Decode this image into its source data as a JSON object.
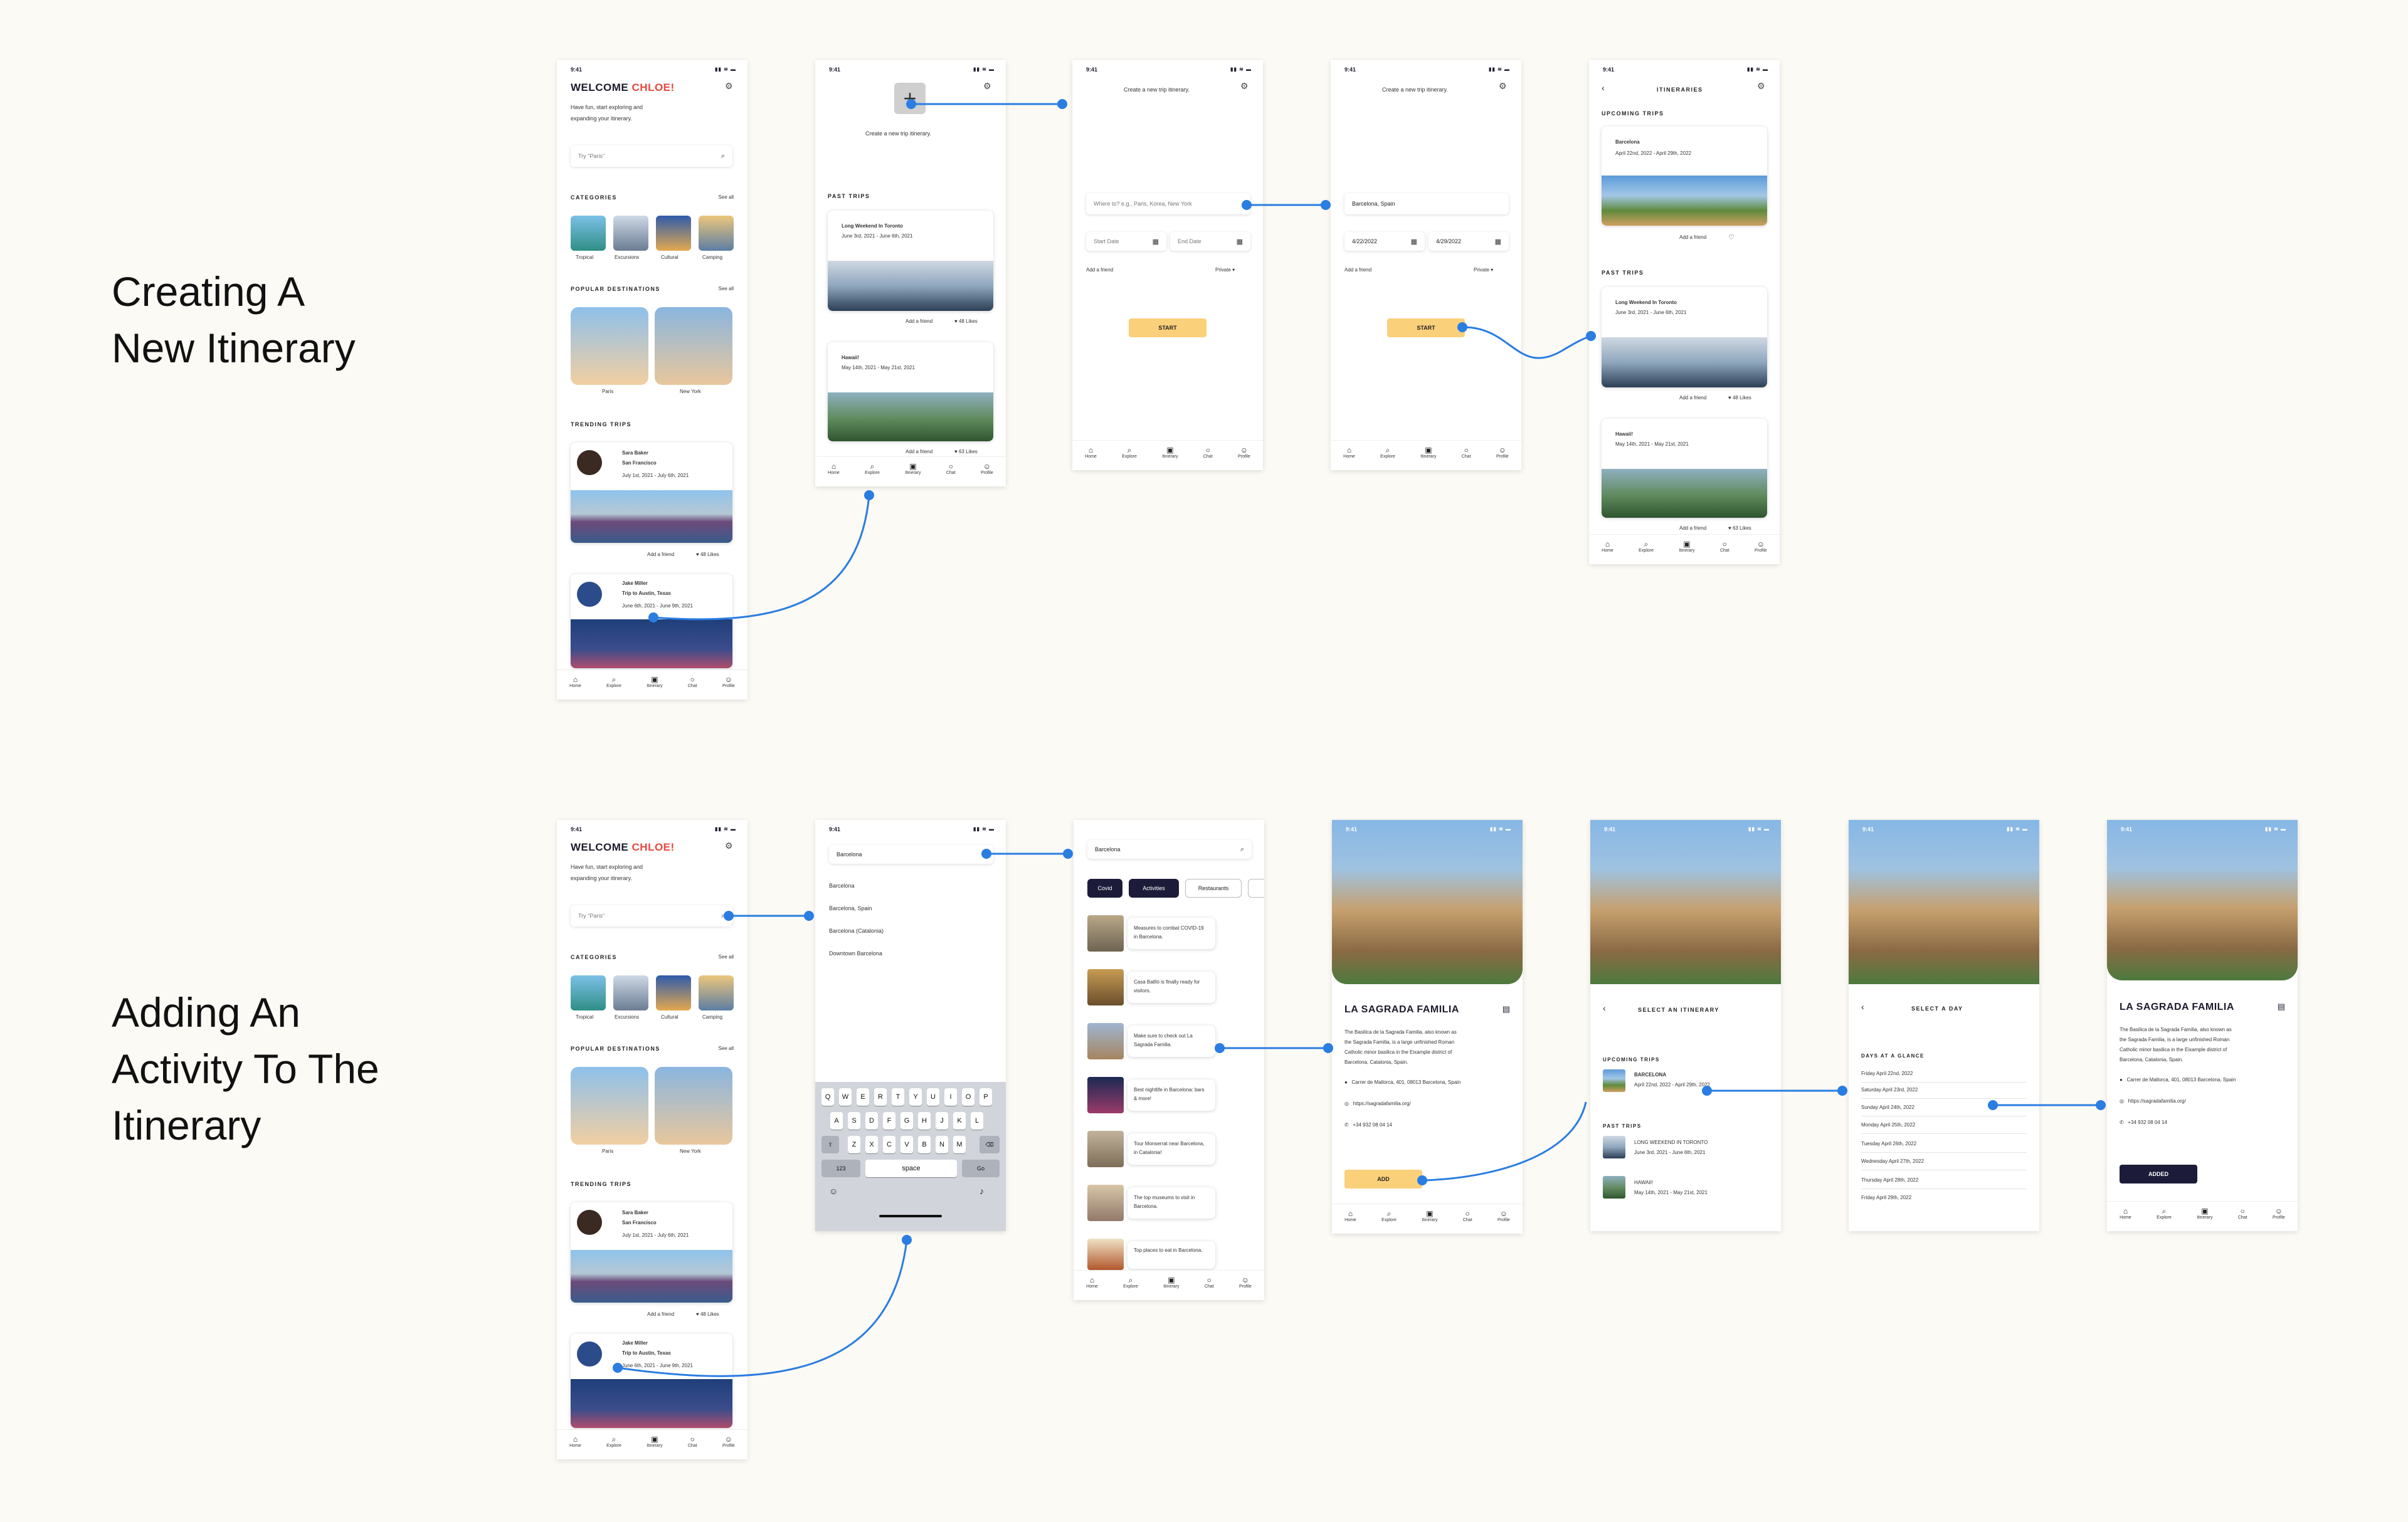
{
  "titles": {
    "section1": "Creating A\nNew Itinerary",
    "section2": "Adding An\nActivity To The\nItinerary"
  },
  "common": {
    "time": "9:41",
    "signal": "▮▮ ≋ ▬",
    "nav": [
      "Home",
      "Explore",
      "Itinerary",
      "Chat",
      "Profile"
    ]
  },
  "home": {
    "welcome": "WELCOME",
    "name": "CHLOE!",
    "subtitle_1": "Have fun, start exploring and",
    "subtitle_2": "expanding your itinerary.",
    "search_placeholder": "Try \"Paris\"",
    "categories_label": "CATEGORIES",
    "see_all": "See all",
    "categories": [
      "Tropical",
      "Excursions",
      "Cultural",
      "Camping"
    ],
    "popular_label": "POPULAR DESTINATIONS",
    "destinations": [
      "Paris",
      "New York"
    ],
    "trending_label": "TRENDING TRIPS",
    "trip1": {
      "name": "Sara Baker",
      "place": "San Francisco",
      "dates": "July 1st, 2021 - July 6th, 2021",
      "friend": "Add a friend",
      "likes": "48 Likes"
    },
    "trip2": {
      "name": "Jake Miller",
      "place": "Trip to Austin, Texas",
      "dates": "June 6th, 2021 - June 9th, 2021"
    }
  },
  "past": {
    "create_text": "Create a new trip itinerary.",
    "past_label": "PAST TRIPS",
    "trip1": {
      "title": "Long Weekend In Toronto",
      "dates": "June 3rd, 2021 - June 6th, 2021",
      "friend": "Add a friend",
      "likes": "48 Likes"
    },
    "trip2": {
      "title": "Hawaii!",
      "dates": "May 14th, 2021 - May 21st, 2021",
      "friend": "Add a friend",
      "likes": "63 Likes"
    }
  },
  "create": {
    "header": "Create a new trip itinerary.",
    "where_placeholder": "Where to?   e.g., Paris, Korea, New York",
    "start_date": "Start Date",
    "end_date": "End Date",
    "add_friend": "Add a friend",
    "privacy": "Private",
    "start_btn": "START",
    "where_value": "Barcelona, Spain",
    "start_value": "4/22/2022",
    "end_value": "4/29/2022"
  },
  "itineraries": {
    "title": "ITINERARIES",
    "upcoming_label": "UPCOMING TRIPS",
    "upcoming": {
      "title": "Barcelona",
      "dates": "April 22nd, 2022 - April 29th, 2022",
      "friend": "Add a friend"
    },
    "past_label": "PAST TRIPS"
  },
  "search": {
    "value": "Barcelona",
    "results": [
      "Barcelona",
      "Barcelona, Spain",
      "Barcelona (Catalonia)",
      "Downtown Barcelona"
    ],
    "kb_row1": [
      "Q",
      "W",
      "E",
      "R",
      "T",
      "Y",
      "U",
      "I",
      "O",
      "P"
    ],
    "kb_row2": [
      "A",
      "S",
      "D",
      "F",
      "G",
      "H",
      "J",
      "K",
      "L"
    ],
    "kb_row3": [
      "Z",
      "X",
      "C",
      "V",
      "B",
      "N",
      "M"
    ],
    "kb_123": "123",
    "kb_space": "space",
    "kb_go": "Go"
  },
  "activities": {
    "tabs": [
      "Covid",
      "Activities",
      "Restaurants"
    ],
    "items": [
      "Measures to combat COVID-19 in Barcelona.",
      "Casa Batlló is finally ready for visitors.",
      "Make sure to check out La Sagrada Familia.",
      "Best nightlife in Barcelona: bars & more!",
      "Tour Monserrat near Barcelona, in Catalonia!",
      "The top museums to visit in Barcelona.",
      "Top places to eat in Barcelona."
    ]
  },
  "detail": {
    "title": "LA SAGRADA FAMILIA",
    "desc": [
      "The Basilica de la Sagrada Familia, also known as",
      "the Sagrada Familia, is a large unfinished Roman",
      "Catholic minor basilica in the Eixample district of",
      "Barcelona, Catalonia, Spain."
    ],
    "address": "Carrer de Mallorca, 401, 08013 Barcelona, Spain",
    "url": "https://sagradafamilia.org/",
    "phone": "+34 932 08 04 14",
    "add_btn": "ADD",
    "added_btn": "ADDED"
  },
  "select_itin": {
    "title": "SELECT AN ITINERARY",
    "upcoming_label": "UPCOMING TRIPS",
    "up_title": "BARCELONA",
    "up_dates": "April 22nd, 2022 - April 29th, 2022",
    "past_label": "PAST TRIPS",
    "p1_title": "LONG WEEKEND IN TORONTO",
    "p1_dates": "June 3rd, 2021 - June 6th, 2021",
    "p2_title": "HAWAII!",
    "p2_dates": "May 14th, 2021 - May 21st, 2021"
  },
  "select_day": {
    "title": "SELECT A DAY",
    "glance_label": "DAYS AT A GLANCE",
    "days": [
      "Friday April 22nd, 2022",
      "Saturday April 23rd, 2022",
      "Sunday April 24th, 2022",
      "Monday April 25th, 2022",
      "Tuesday April 26th, 2022",
      "Wednesday April 27th, 2022",
      "Thursday April 28th, 2022",
      "Friday April 29th, 2022"
    ]
  },
  "colors": {
    "accent": "#e8473c",
    "connector": "#2a7de1",
    "yellow": "#fbd07a",
    "dark": "#1c1c3a"
  }
}
